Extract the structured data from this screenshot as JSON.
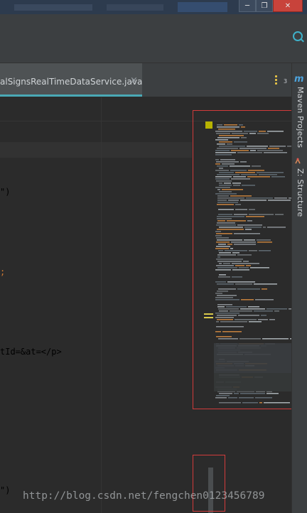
{
  "window": {
    "minimize_glyph": "─",
    "maximize_glyph": "❐",
    "close_glyph": "✕"
  },
  "editor_tab": {
    "label": "alSignsRealTimeDataService.java",
    "close_glyph": "×",
    "tab_count": "3"
  },
  "tool_windows": {
    "maven_icon": "m",
    "maven_label": "Maven Projects",
    "structure_label": "Z: Structure"
  },
  "code_fragments": [
    {
      "text": "\")",
      "color": "#a9b7c6"
    },
    {
      "text": ";",
      "color": "#cc7832"
    },
    {
      "text": "tId=&at=</p>",
      "color": "#a9b7c6"
    },
    {
      "text": "\")",
      "color": "#a9b7c6"
    }
  ],
  "watermark": "http://blog.csdn.net/fengchen0123456789",
  "icons": [
    "search-icon",
    "close-icon",
    "minimize-icon",
    "maximize-icon",
    "tabs-menu-icon",
    "maven-icon",
    "structure-icon"
  ],
  "colors": {
    "accent_tab_underline": "#4aa9b6",
    "highlight_box": "#d23b3b",
    "editor_bg": "#2b2b2b",
    "panel_bg": "#3c3f41"
  }
}
